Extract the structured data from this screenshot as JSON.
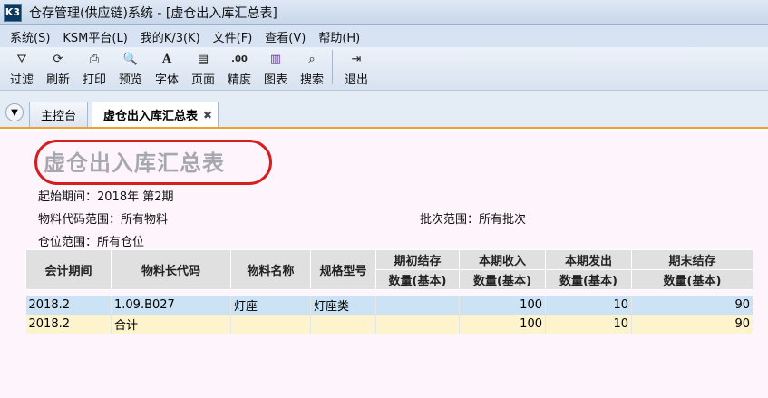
{
  "window": {
    "title": "仓存管理(供应链)系统 - [虚仓出入库汇总表]",
    "logo_text": "K3"
  },
  "menu": [
    {
      "label": "系统(S)"
    },
    {
      "label": "KSM平台(L)"
    },
    {
      "label": "我的K/3(K)"
    },
    {
      "label": "文件(F)"
    },
    {
      "label": "查看(V)"
    },
    {
      "label": "帮助(H)"
    }
  ],
  "toolbar": [
    {
      "label": "过滤",
      "icon": "filter-icon",
      "glyph": "⛛"
    },
    {
      "label": "刷新",
      "icon": "refresh-icon",
      "glyph": "⟳"
    },
    {
      "label": "打印",
      "icon": "print-icon",
      "glyph": "⎙"
    },
    {
      "label": "预览",
      "icon": "preview-icon",
      "glyph": "🔍"
    },
    {
      "label": "字体",
      "icon": "font-icon",
      "glyph": "A"
    },
    {
      "label": "页面",
      "icon": "page-icon",
      "glyph": "▤"
    },
    {
      "label": "精度",
      "icon": "precision-icon",
      "glyph": ".00"
    },
    {
      "label": "图表",
      "icon": "chart-icon",
      "glyph": "▥"
    },
    {
      "label": "搜索",
      "icon": "search-icon",
      "glyph": "⌕"
    },
    {
      "label": "退出",
      "icon": "exit-icon",
      "glyph": "⇥"
    }
  ],
  "tabs": [
    {
      "label": "主控台"
    },
    {
      "label": "虚仓出入库汇总表",
      "close_glyph": "✖"
    }
  ],
  "report": {
    "title": "虚仓出入库汇总表",
    "start_period": "起始期间：2018年  第2期",
    "material_range": "物料代码范围：所有物料",
    "batch_range": "批次范围：所有批次",
    "location_range": "仓位范围：所有仓位"
  },
  "table": {
    "headers": {
      "period": "会计期间",
      "code": "物料长代码",
      "name": "物料名称",
      "spec": "规格型号",
      "opening_1": "期初结存",
      "opening_2": "数量(基本)",
      "in_1": "本期收入",
      "in_2": "数量(基本)",
      "out_1": "本期发出",
      "out_2": "数量(基本)",
      "closing_1": "期末结存",
      "closing_2": "数量(基本)"
    },
    "rows": [
      {
        "period": "2018.2",
        "code": "1.09.B027",
        "name": "灯座",
        "spec": "灯座类",
        "opening": "",
        "in": "100",
        "out": "10",
        "closing": "90"
      },
      {
        "period": "2018.2",
        "code": "合计",
        "name": "",
        "spec": "",
        "opening": "",
        "in": "100",
        "out": "10",
        "closing": "90"
      }
    ]
  },
  "colors": {
    "accent": "#f0a030",
    "highlight_ring": "#d61e1e",
    "selected_row": "#cbe3f4",
    "total_row": "#fdf3cc"
  }
}
